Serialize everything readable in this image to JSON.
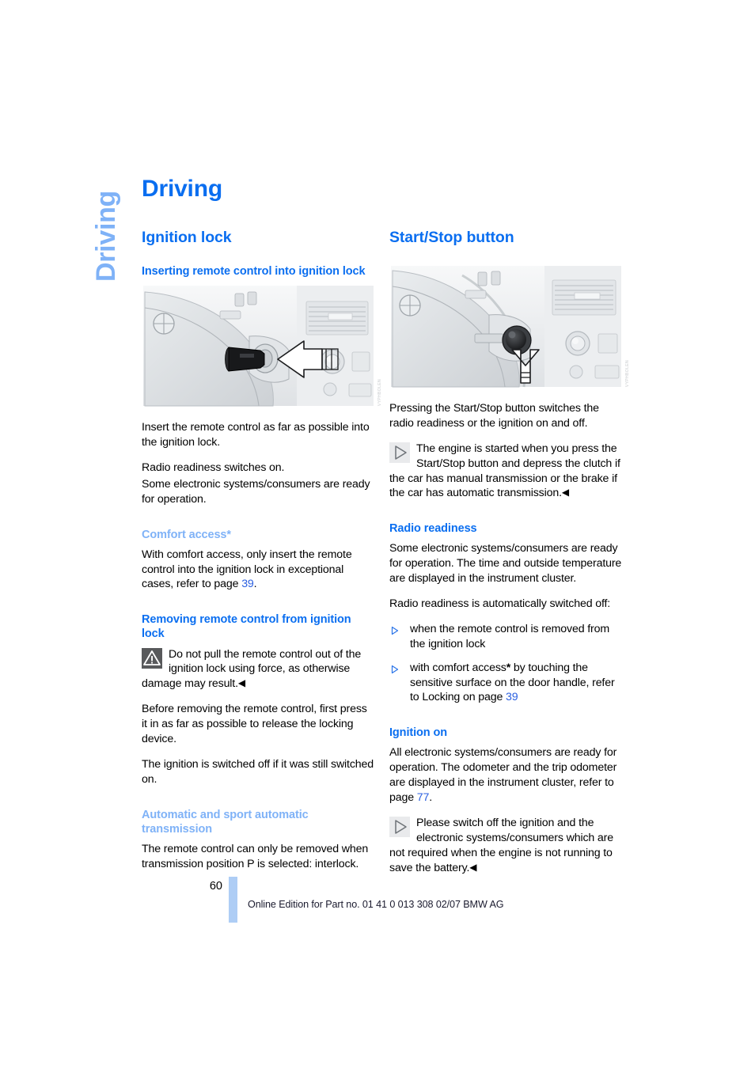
{
  "chapter_tab": "Driving",
  "page_title": "Driving",
  "colors": {
    "heading_blue": "#0a6ef0",
    "light_blue": "#7fb2f7",
    "page_ref_blue": "#2a5fe0",
    "footer_bar_blue": "#aecdf5"
  },
  "left_column": {
    "section_title": "Ignition lock",
    "sub_insert": "Inserting remote control into ignition lock",
    "figure_insert_code": "VYPHBOLEN",
    "p_insert": "Insert the remote control as far as possible into the ignition lock.",
    "p_radio_line1": "Radio readiness switches on.",
    "p_radio_line2": "Some electronic systems/consumers are ready for operation.",
    "sub_comfort": "Comfort access*",
    "p_comfort_pre": "With comfort access, only insert the remote control into the ignition lock in exceptional cases, refer to page ",
    "p_comfort_ref": "39",
    "p_comfort_post": ".",
    "sub_removing": "Removing remote control from ignition lock",
    "warn_text": "Do not pull the remote control out of the ignition lock using force, as otherwise damage may result.",
    "p_before_removing": "Before removing the remote control, first press it in as far as possible to release the locking device.",
    "p_ignition_off": "The ignition is switched off if it was still switched on.",
    "sub_automatic": "Automatic and sport automatic transmission",
    "p_automatic": "The remote control can only be removed when transmission position P is selected: interlock."
  },
  "right_column": {
    "section_title": "Start/Stop button",
    "figure_startstop_code": "VYPHBOLEN",
    "p_pressing": "Pressing the Start/Stop button switches the radio readiness or the ignition on and off.",
    "note_engine": "The engine is started when you press the Start/Stop button and depress the clutch if the car has manual transmission or the brake if the car has automatic transmission.",
    "sub_radio_readiness": "Radio readiness",
    "p_radio_systems": "Some electronic systems/consumers are ready for operation. The time and outside temperature are displayed in the instrument cluster.",
    "p_radio_off": "Radio readiness is automatically switched off:",
    "bullet_1": "when the remote control is removed from the ignition lock",
    "bullet_2_pre": "with comfort access",
    "bullet_2_star": "*",
    "bullet_2_mid": " by touching the sensitive surface on the door handle, refer to Locking on page ",
    "bullet_2_ref": "39",
    "sub_ignition_on": "Ignition on",
    "p_ignition_pre": "All electronic systems/consumers are ready for operation. The odometer and the trip odometer are displayed in the instrument cluster, refer to page ",
    "p_ignition_ref": "77",
    "p_ignition_post": ".",
    "note_battery": "Please switch off the ignition and the electronic systems/consumers which are not required when the engine is not running to save the battery."
  },
  "footer": {
    "page_number": "60",
    "text": "Online Edition for Part no. 01 41 0 013 308 02/07 BMW AG"
  }
}
